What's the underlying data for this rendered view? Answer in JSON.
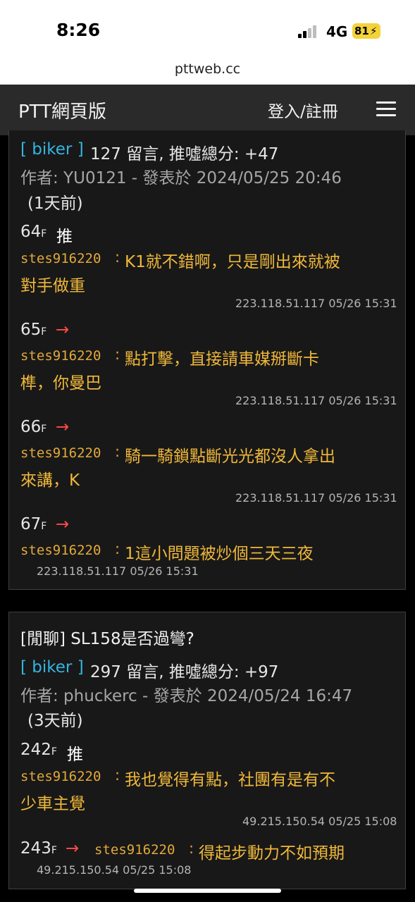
{
  "status": {
    "time": "8:26",
    "network": "4G",
    "battery": "81"
  },
  "browser": {
    "url": "pttweb.cc"
  },
  "nav": {
    "brand": "PTT網頁版",
    "login": "登入/註冊"
  },
  "posts": [
    {
      "board": "[ biker ]",
      "stats": "127 留言, 推噓總分: +47",
      "author_line": "作者: YU0121 - 發表於 2024/05/25 20:46",
      "ago": "(1天前)",
      "comments": [
        {
          "floor": "64",
          "f": "F",
          "tag": "推",
          "user": "stes916220",
          "colon": ":",
          "text1": "K1就不錯啊，只是剛出來就被",
          "text2": "對手做重",
          "meta": "223.118.51.117 05/26 15:31"
        },
        {
          "floor": "65",
          "f": "F",
          "tag": "→",
          "user": "stes916220",
          "colon": ":",
          "text1": "點打擊，直接請車媒掰斷卡",
          "text2": "榫，你曼巴",
          "meta": "223.118.51.117 05/26 15:31"
        },
        {
          "floor": "66",
          "f": "F",
          "tag": "→",
          "user": "stes916220",
          "colon": ":",
          "text1": "騎一騎鎖點斷光光都沒人拿出",
          "text2": "來講，K",
          "meta": "223.118.51.117 05/26 15:31"
        },
        {
          "floor": "67",
          "f": "F",
          "tag": "→",
          "user": "stes916220",
          "colon": ":",
          "text1": "1這小問題被炒個三天三夜",
          "meta": "223.118.51.117 05/26 15:31"
        }
      ]
    },
    {
      "title": "[閒聊] SL158是否過彎?",
      "board": "[ biker ]",
      "stats": "297 留言, 推噓總分: +97",
      "author_line": "作者: phuckerc - 發表於 2024/05/24 16:47",
      "ago": "(3天前)",
      "comments": [
        {
          "floor": "242",
          "f": "F",
          "tag": "推",
          "user": "stes916220",
          "colon": ":",
          "text1": "我也覺得有點，社團有是有不",
          "text2": "少車主覺",
          "meta": "49.215.150.54 05/25 15:08"
        },
        {
          "floor": "243",
          "f": "F",
          "tag": "→",
          "user": "stes916220",
          "colon": ":",
          "text1": "得起步動力不如預期",
          "meta": "49.215.150.54 05/25 15:08"
        }
      ]
    }
  ]
}
